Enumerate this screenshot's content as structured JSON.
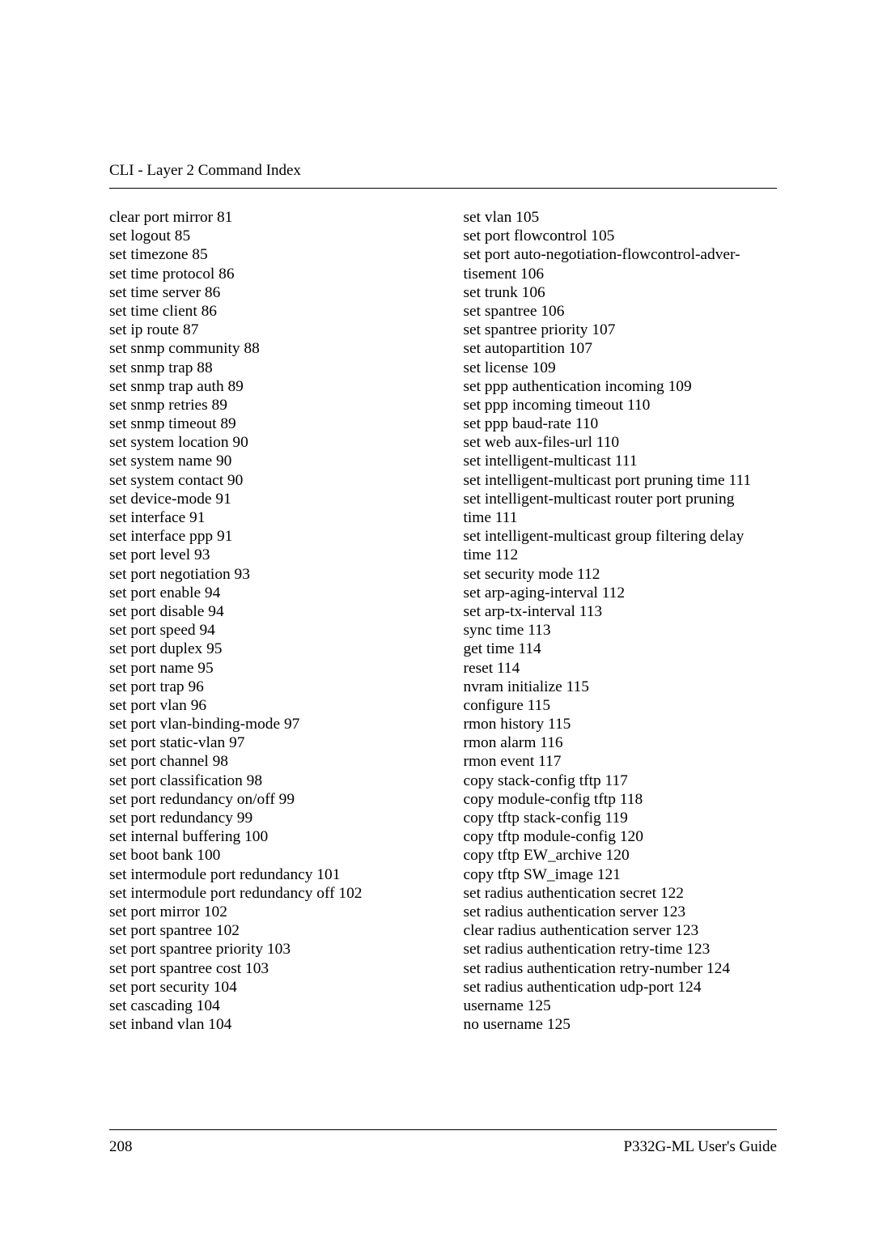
{
  "header": "CLI - Layer 2 Command Index",
  "page_number": "208",
  "guide_title": "P332G-ML User's Guide",
  "left_col": [
    "clear port mirror 81",
    "set logout 85",
    "set timezone 85",
    "set time protocol 86",
    "set time server 86",
    "set time client 86",
    "set ip route 87",
    "set snmp community 88",
    "set snmp trap 88",
    "set snmp trap auth 89",
    "set snmp retries 89",
    "set snmp timeout 89",
    "set system location 90",
    "set system name 90",
    "set system contact 90",
    "set device-mode 91",
    "set interface 91",
    "set interface ppp 91",
    "set port level 93",
    "set port negotiation 93",
    "set port enable 94",
    "set port disable 94",
    "set port speed 94",
    "set port duplex 95",
    "set port name 95",
    "set port trap 96",
    "set port vlan 96",
    "set port vlan-binding-mode 97",
    "set port static-vlan 97",
    "set port channel 98",
    "set port classification 98",
    "set port redundancy on/off 99",
    "set port redundancy 99",
    "set internal buffering 100",
    "set boot bank 100",
    "set intermodule port redundancy 101",
    "set intermodule port redundancy off 102",
    "set port mirror 102",
    "set port spantree 102",
    "set port spantree priority 103",
    "set port spantree cost 103",
    "set port security 104",
    "set cascading 104",
    "set inband vlan 104"
  ],
  "right_col": [
    "set vlan 105",
    "set port flowcontrol 105",
    "set port auto-negotiation-flowcontrol-adver-",
    "tisement 106",
    "set trunk 106",
    "set spantree 106",
    "set spantree priority 107",
    "set autopartition 107",
    "set license 109",
    "set ppp authentication incoming 109",
    "set ppp incoming timeout 110",
    "set ppp baud-rate 110",
    "set web aux-files-url 110",
    "set intelligent-multicast 111",
    "set intelligent-multicast port pruning time 111",
    "set intelligent-multicast router port pruning",
    "time 111",
    "set intelligent-multicast group filtering delay",
    "time 112",
    "set security mode 112",
    "set arp-aging-interval 112",
    "set arp-tx-interval 113",
    "sync time 113",
    "get time 114",
    "reset 114",
    "nvram initialize 115",
    "configure 115",
    "rmon history 115",
    "rmon alarm 116",
    "rmon event 117",
    "copy stack-config tftp 117",
    "copy module-config tftp 118",
    "copy tftp stack-config 119",
    "copy tftp module-config 120",
    "copy tftp EW_archive 120",
    "copy tftp SW_image 121",
    "set radius authentication secret 122",
    "set radius authentication server 123",
    "clear radius authentication server 123",
    "set radius authentication retry-time 123",
    "set radius authentication retry-number 124",
    "set radius authentication udp-port 124",
    "username 125",
    "no username 125"
  ]
}
